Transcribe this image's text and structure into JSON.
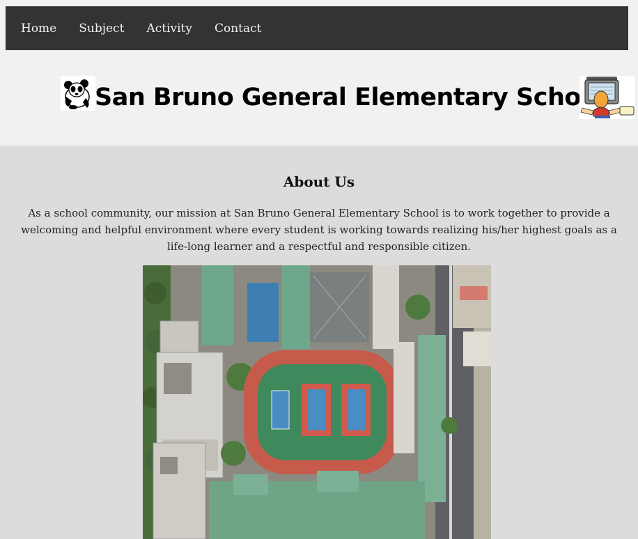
{
  "nav": {
    "items": [
      {
        "label": "Home"
      },
      {
        "label": "Subject"
      },
      {
        "label": "Activity"
      },
      {
        "label": "Contact"
      }
    ]
  },
  "header": {
    "title": "San Bruno General Elementary School",
    "left_logo_icon": "panda-icon",
    "right_logo_icon": "computer-kid-icon"
  },
  "about": {
    "heading": "About Us",
    "body": "As a school community, our mission at San Bruno General Elementary School is to work together to provide a welcoming and helpful environment where every student is working towards realizing his/her highest goals as a life-long learner and a respectful and responsible citizen."
  },
  "colors": {
    "navbar": "#333333",
    "nav_text": "#f2f2f2",
    "header_bg": "#f1f1f1",
    "page_bg": "#dcdcdc"
  }
}
